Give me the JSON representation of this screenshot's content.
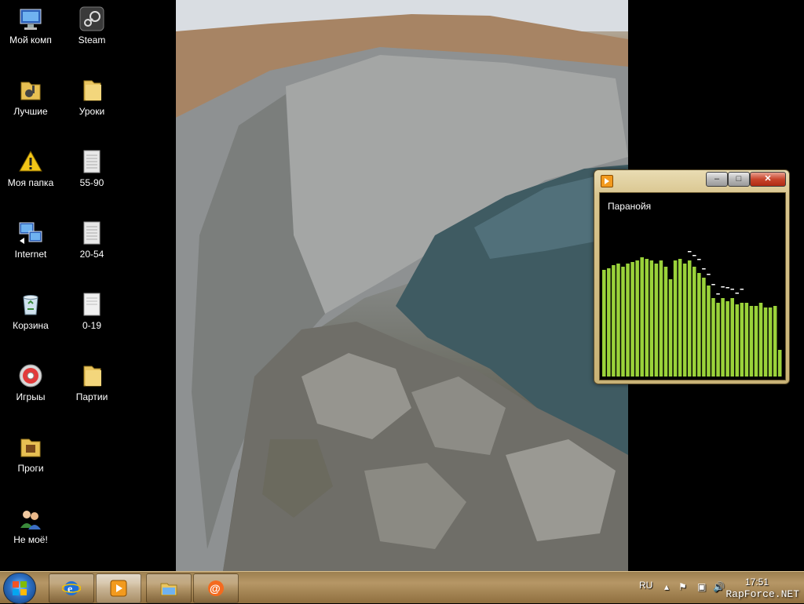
{
  "desktop": {
    "icons": [
      {
        "label": "Мой комп",
        "icon": "computer-icon"
      },
      {
        "label": "Steam",
        "icon": "steam-icon"
      },
      {
        "label": "Лучшие",
        "icon": "music-folder-icon"
      },
      {
        "label": "Уроки",
        "icon": "folder-icon"
      },
      {
        "label": "Моя папка",
        "icon": "warning-icon"
      },
      {
        "label": "55-90",
        "icon": "document-icon"
      },
      {
        "label": "Internet",
        "icon": "network-icon"
      },
      {
        "label": "20-54",
        "icon": "document-icon"
      },
      {
        "label": "Корзина",
        "icon": "recycle-bin-icon"
      },
      {
        "label": "0-19",
        "icon": "document-icon"
      },
      {
        "label": "Игрыы",
        "icon": "disc-icon"
      },
      {
        "label": "Партии",
        "icon": "folder-icon"
      },
      {
        "label": "Проги",
        "icon": "music-folder-icon"
      },
      {
        "label": "Не моё!",
        "icon": "users-icon"
      }
    ]
  },
  "player": {
    "track": "Паранойя",
    "buttons": {
      "minimize": "–",
      "maximize": "□",
      "close": "✕"
    },
    "spectrum_levels": [
      0.68,
      0.69,
      0.71,
      0.72,
      0.7,
      0.72,
      0.73,
      0.74,
      0.76,
      0.75,
      0.74,
      0.72,
      0.74,
      0.7,
      0.62,
      0.74,
      0.75,
      0.72,
      0.74,
      0.7,
      0.66,
      0.63,
      0.58,
      0.5,
      0.47,
      0.5,
      0.48,
      0.5,
      0.46,
      0.47,
      0.47,
      0.45,
      0.45,
      0.47,
      0.44,
      0.44,
      0.45,
      0.17
    ],
    "colors": {
      "bar": "#9ad23a",
      "peak": "#ffffff"
    }
  },
  "taskbar": {
    "buttons": [
      {
        "name": "ie-icon",
        "label": "Internet Explorer"
      },
      {
        "name": "media-player-icon",
        "label": "Media Player"
      },
      {
        "name": "folder-icon",
        "label": "Explorer"
      },
      {
        "name": "mail-agent-icon",
        "label": "Mail"
      }
    ],
    "language": "RU",
    "clock": "17:51"
  },
  "watermark": "RapForce.NET"
}
